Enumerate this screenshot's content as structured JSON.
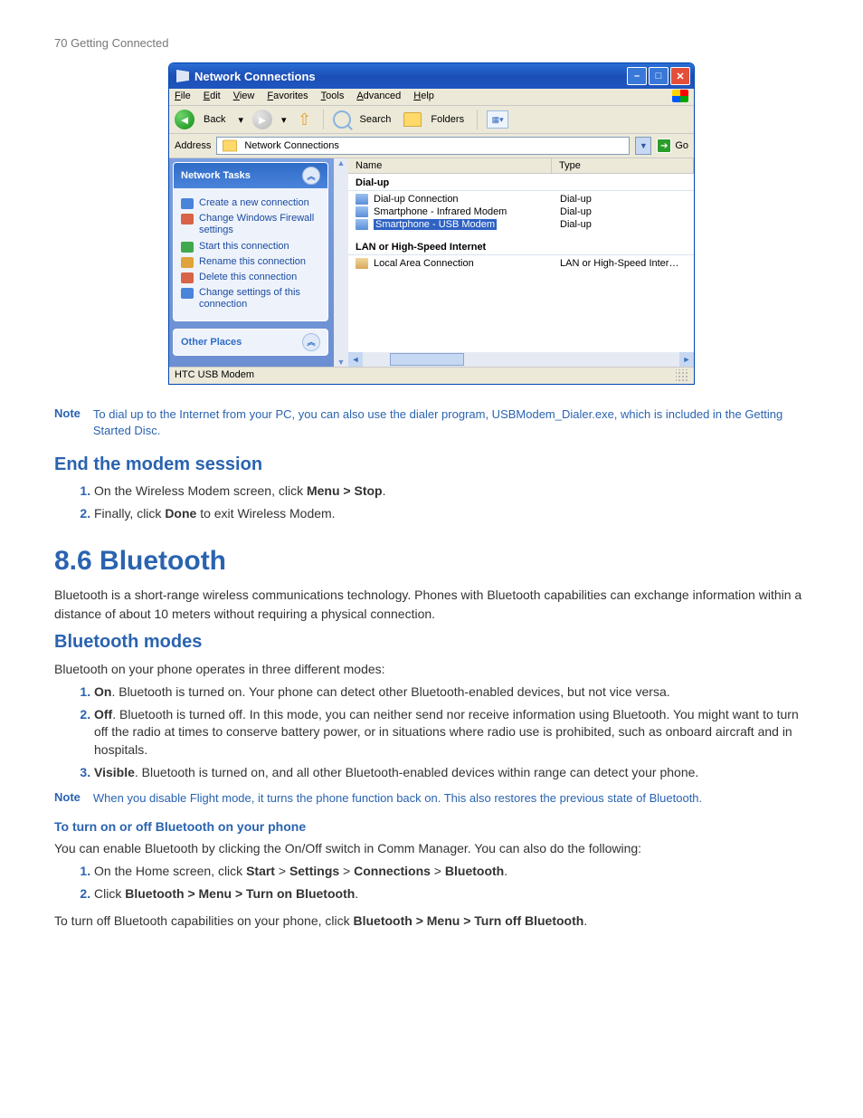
{
  "page_header": "70  Getting Connected",
  "xp": {
    "title": "Network Connections",
    "menus": [
      "File",
      "Edit",
      "View",
      "Favorites",
      "Tools",
      "Advanced",
      "Help"
    ],
    "toolbar": {
      "back": "Back",
      "search": "Search",
      "folders": "Folders"
    },
    "address": {
      "label": "Address",
      "value": "Network Connections",
      "go": "Go"
    },
    "side": {
      "tasks_hdr": "Network Tasks",
      "links": [
        "Create a new connection",
        "Change Windows Firewall settings",
        "Start this connection",
        "Rename this connection",
        "Delete this connection",
        "Change settings of this connection"
      ],
      "other_hdr": "Other Places"
    },
    "cols": {
      "name": "Name",
      "type": "Type"
    },
    "groups": [
      {
        "label": "Dial-up",
        "rows": [
          {
            "name": "Dial-up Connection",
            "type": "Dial-up",
            "sel": false
          },
          {
            "name": "Smartphone - Infrared Modem",
            "type": "Dial-up",
            "sel": false
          },
          {
            "name": "Smartphone - USB Modem",
            "type": "Dial-up",
            "sel": true
          }
        ]
      },
      {
        "label": "LAN or High-Speed Internet",
        "rows": [
          {
            "name": "Local Area Connection",
            "type": "LAN or High-Speed Inter…",
            "sel": false
          }
        ]
      }
    ],
    "status": "HTC USB Modem"
  },
  "note1": {
    "label": "Note",
    "text": "To dial up to the Internet from your PC, you can also use the dialer program, USBModem_Dialer.exe, which is included in the Getting Started Disc."
  },
  "sec_end": "End the modem session",
  "end_steps": [
    {
      "pre": "On the Wireless Modem screen, click ",
      "b": "Menu > Stop",
      "post": "."
    },
    {
      "pre": "Finally, click ",
      "b": "Done",
      "post": " to exit Wireless Modem."
    }
  ],
  "chapter": "8.6  Bluetooth",
  "bt_intro": "Bluetooth is a short-range wireless communications technology. Phones with Bluetooth capabilities can exchange information within a distance of about 10 meters without requiring a physical connection.",
  "sec_modes": "Bluetooth modes",
  "modes_intro": "Bluetooth on your phone operates in three different modes:",
  "modes": [
    {
      "b": "On",
      "t": ". Bluetooth is turned on. Your phone can detect other Bluetooth-enabled devices, but not vice versa."
    },
    {
      "b": "Off",
      "t": ". Bluetooth is turned off. In this mode, you can neither send nor receive information using Bluetooth. You might want to turn off the radio at times to conserve battery power, or in situations where radio use is prohibited, such as onboard aircraft and in hospitals."
    },
    {
      "b": "Visible",
      "t": ". Bluetooth is turned on, and all other Bluetooth-enabled devices within range can detect your phone."
    }
  ],
  "note2": {
    "label": "Note",
    "text": "When you disable Flight mode, it turns the phone function back on. This also restores the previous state of Bluetooth."
  },
  "sub_turn": "To turn on or off Bluetooth on your phone",
  "turn_intro": "You can enable Bluetooth by clicking the On/Off switch in Comm Manager. You can also do the following:",
  "turn_steps": {
    "s1_pre": "On the Home screen, click ",
    "s1_b1": "Start",
    "s1_g1": " > ",
    "s1_b2": "Settings",
    "s1_g2": " > ",
    "s1_b3": "Connections",
    "s1_g3": " > ",
    "s1_b4": "Bluetooth",
    "s1_post": ".",
    "s2_pre": "Click ",
    "s2_b": "Bluetooth > Menu > Turn on Bluetooth",
    "s2_post": "."
  },
  "turn_off_pre": "To turn off Bluetooth capabilities on your phone, click ",
  "turn_off_b": "Bluetooth > Menu > Turn off Bluetooth",
  "turn_off_post": "."
}
